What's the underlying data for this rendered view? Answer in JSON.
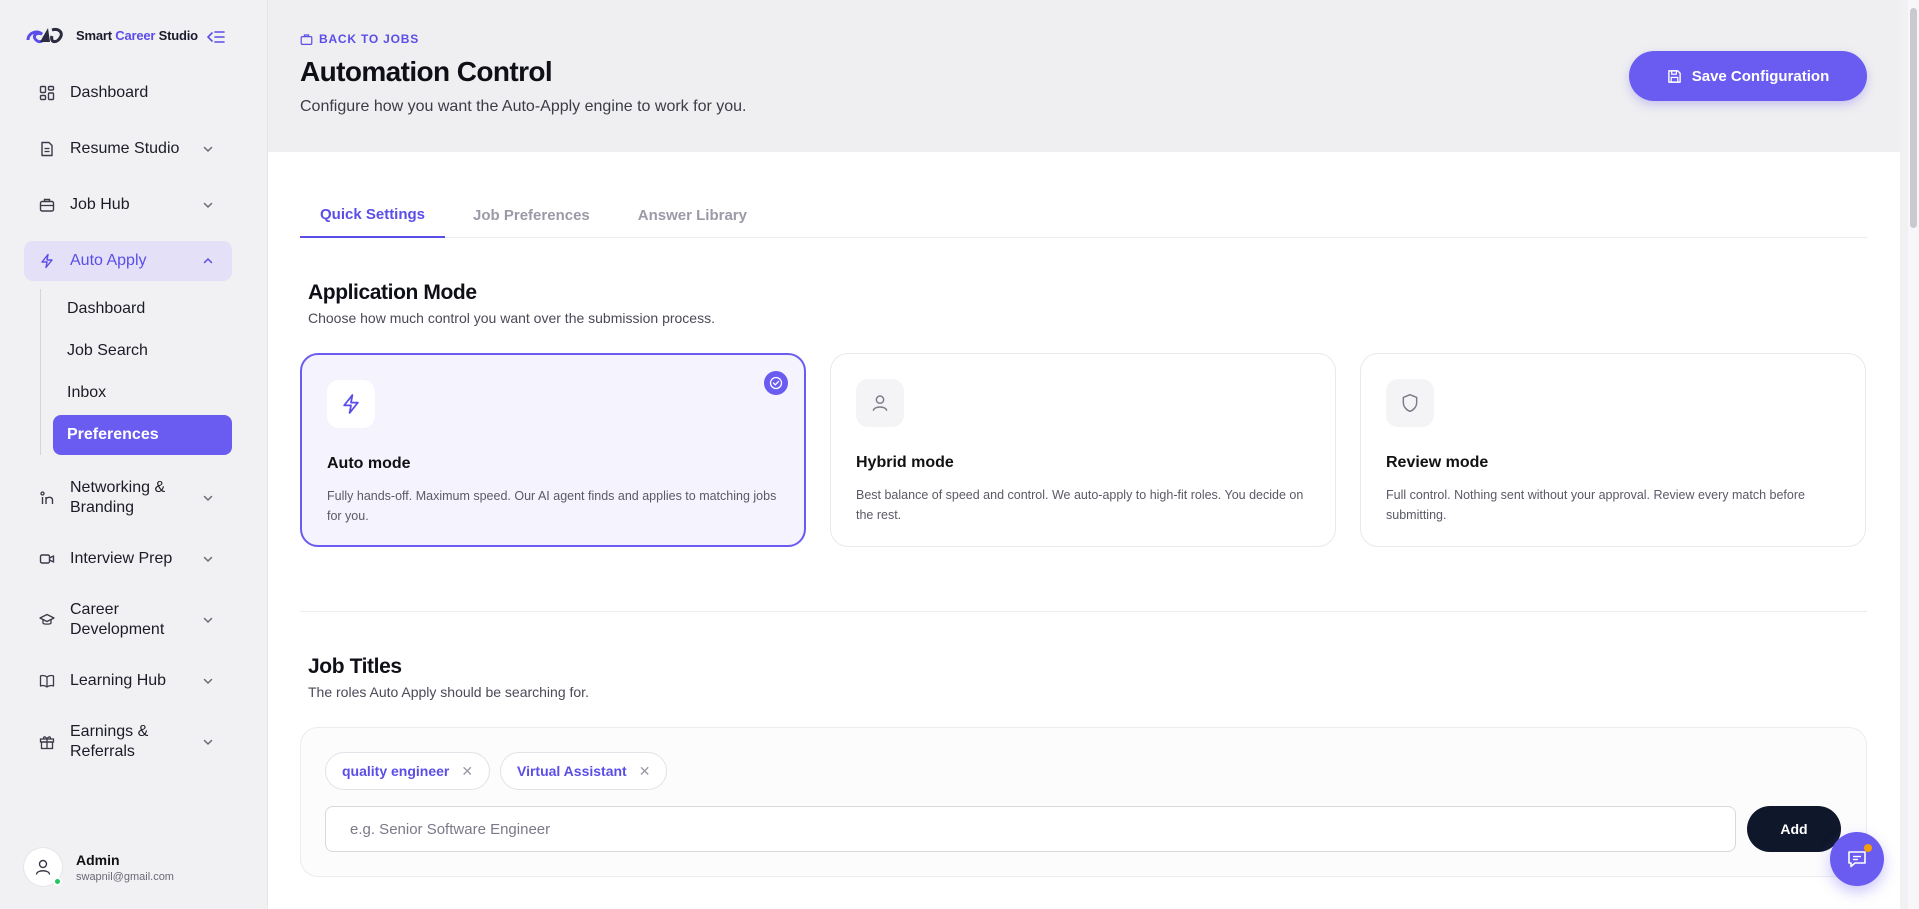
{
  "brand": {
    "name_prefix": "Smart ",
    "name_accent": "Career",
    "name_suffix": " Studio"
  },
  "sidebar": {
    "items": [
      {
        "label": "Dashboard",
        "icon": "dashboard-icon"
      },
      {
        "label": "Resume Studio",
        "icon": "document-icon"
      },
      {
        "label": "Job Hub",
        "icon": "briefcase-icon"
      },
      {
        "label": "Auto Apply",
        "icon": "bolt-icon"
      },
      {
        "label": "Networking & Branding",
        "icon": "network-icon"
      },
      {
        "label": "Interview Prep",
        "icon": "video-icon"
      },
      {
        "label": "Career Development",
        "icon": "graduation-cap-icon"
      },
      {
        "label": "Learning Hub",
        "icon": "book-icon"
      },
      {
        "label": "Earnings & Referrals",
        "icon": "gift-icon"
      }
    ],
    "sub_items": [
      {
        "label": "Dashboard"
      },
      {
        "label": "Job Search"
      },
      {
        "label": "Inbox"
      },
      {
        "label": "Preferences"
      }
    ]
  },
  "user": {
    "name": "Admin",
    "email": "swapnil@gmail.com"
  },
  "header": {
    "back_label": "BACK TO JOBS",
    "title": "Automation Control",
    "subtitle": "Configure how you want the Auto-Apply engine to work for you.",
    "save_label": "Save Configuration"
  },
  "tabs": [
    {
      "label": "Quick Settings"
    },
    {
      "label": "Job Preferences"
    },
    {
      "label": "Answer Library"
    }
  ],
  "application_mode": {
    "title": "Application Mode",
    "subtitle": "Choose how much control you want over the submission process.",
    "modes": [
      {
        "name": "Auto mode",
        "description": "Fully hands-off. Maximum speed. Our AI agent finds and applies to matching jobs for you.",
        "icon": "bolt-icon",
        "selected": true
      },
      {
        "name": "Hybrid mode",
        "description": "Best balance of speed and control. We auto-apply to high-fit roles. You decide on the rest.",
        "icon": "user-icon",
        "selected": false
      },
      {
        "name": "Review mode",
        "description": "Full control. Nothing sent without your approval. Review every match before submitting.",
        "icon": "shield-icon",
        "selected": false
      }
    ]
  },
  "job_titles": {
    "title": "Job Titles",
    "subtitle": "The roles Auto Apply should be searching for.",
    "chips": [
      {
        "label": "quality engineer"
      },
      {
        "label": "Virtual Assistant"
      }
    ],
    "input_placeholder": "e.g. Senior Software Engineer",
    "input_value": "",
    "add_label": "Add"
  },
  "colors": {
    "accent": "#6a5cf0",
    "dark_button": "#0f172a",
    "notification": "#f59e0b",
    "online": "#22c55e"
  }
}
